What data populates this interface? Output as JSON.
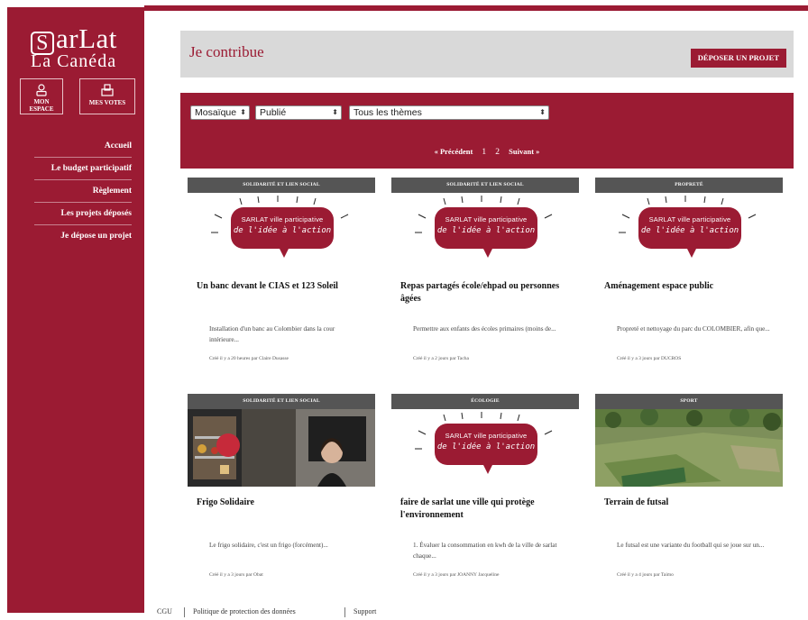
{
  "brand": {
    "line1": "SARLAT",
    "line1_s": "S",
    "line1_rest": "arLat",
    "line2": "La Canéda"
  },
  "sidebar": {
    "btn_espace": {
      "line1": "MON",
      "line2": "ESPACE"
    },
    "btn_votes": "MES VOTES",
    "items": [
      {
        "label": "Accueil"
      },
      {
        "label": "Le budget participatif"
      },
      {
        "label": "Règlement"
      },
      {
        "label": "Les projets déposés"
      },
      {
        "label": "Je dépose un projet"
      }
    ]
  },
  "header": {
    "title": "Je contribue",
    "deposer_label": "DÉPOSER UN PROJET"
  },
  "filters": {
    "view": "Mosaïque",
    "status": "Publié",
    "themes": "Tous les thèmes"
  },
  "pager": {
    "prev": "« Précédent",
    "page1": "1",
    "page2": "2",
    "next": "Suivant »"
  },
  "bubble": {
    "line1": "SARLAT ville participative",
    "line2": "de l'idée à l'action"
  },
  "cards": [
    {
      "category": "Solidarité et lien social",
      "title": "Un banc devant le CIAS et 123 Soleil",
      "desc": "Installation d'un banc au Colombier dans la cour intérieure...",
      "meta": "Créé il y a 20 heures par Claire Dusasse",
      "image": "bubble"
    },
    {
      "category": "Solidarité et lien social",
      "title": "Repas partagés école/ehpad ou personnes âgées",
      "desc": "Permettre aux enfants des écoles primaires (moins de...",
      "meta": "Créé il y a 2 jours par Tacha",
      "image": "bubble"
    },
    {
      "category": "Propreté",
      "title": "Aménagement espace public",
      "desc": "Propreté et nettoyage du parc du COLOMBIER, afin que...",
      "meta": "Créé il y a 3 jours par DUCROS",
      "image": "bubble"
    },
    {
      "category": "Solidarité et lien social",
      "title": "Frigo Solidaire",
      "desc": "Le frigo solidaire, c'est un frigo (forcément)...",
      "meta": "Créé il y a 3 jours par Obat",
      "image": "photo-frigo"
    },
    {
      "category": "Écologie",
      "title": "faire de sarlat une ville qui protège l'environnement",
      "desc": "1. Évaluer la consommation en kwh de la ville de sarlat chaque...",
      "meta": "Créé il y a 3 jours par JOANNY Jacqueline",
      "image": "bubble"
    },
    {
      "category": "Sport",
      "title": "Terrain de futsal",
      "desc": "Le futsal est une variante du football qui se joue sur un...",
      "meta": "Créé il y a 4 jours par Taimo",
      "image": "photo-terrain"
    }
  ],
  "footer": {
    "cgu": "CGU",
    "privacy": "Politique de protection des données",
    "support": "Support"
  },
  "colors": {
    "accent": "#9b1b33",
    "category_bar": "#555555",
    "header_bg": "#d9d9d9"
  }
}
